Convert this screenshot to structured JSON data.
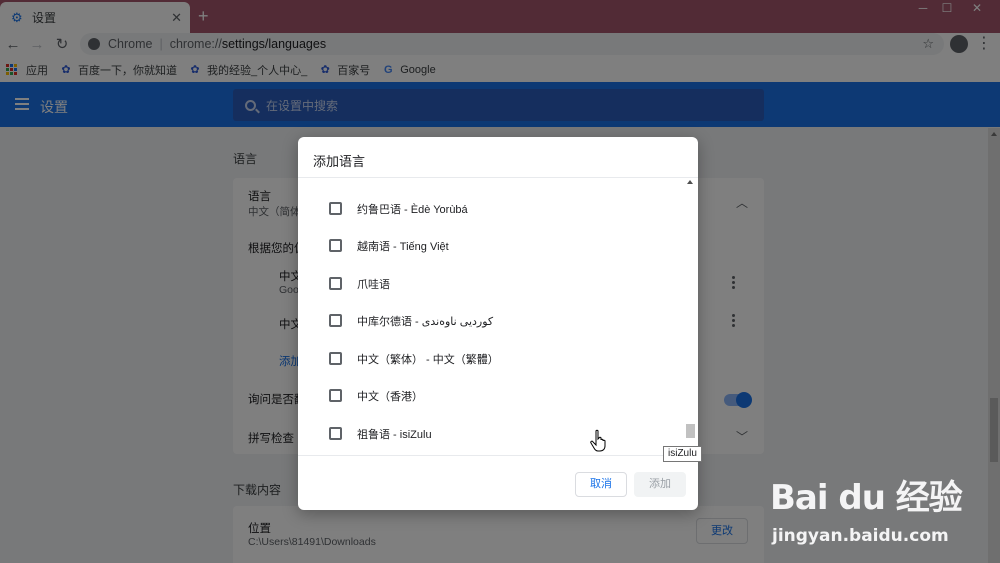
{
  "browser": {
    "tab": {
      "title": "设置",
      "icon": "gear-icon"
    },
    "window_controls": {
      "minimize": "─",
      "maximize": "☐",
      "close": "✕"
    },
    "omnibox": {
      "origin": "Chrome",
      "url_scheme": "chrome://",
      "url_path": "settings/languages"
    },
    "bookmarks": [
      {
        "label": "应用",
        "icon": "apps-grid-icon"
      },
      {
        "label": "百度一下，你就知道",
        "icon": "baidu-paw-icon"
      },
      {
        "label": "我的经验_个人中心_",
        "icon": "baidu-paw-icon"
      },
      {
        "label": "百家号",
        "icon": "baidu-paw-icon"
      },
      {
        "label": "Google",
        "icon": "google-g-icon"
      }
    ]
  },
  "settings": {
    "title": "设置",
    "search_placeholder": "在设置中搜索",
    "languages_section_title": "语言",
    "languages_card": {
      "label": "语言",
      "sub": "中文（简体",
      "order_label": "根据您的偏",
      "items": [
        {
          "name": "中文",
          "sub": "Goo"
        },
        {
          "name": "中文",
          "sub": ""
        }
      ],
      "add_link": "添加",
      "ask_translate": "询问是否翻",
      "spellcheck": "拼写检查"
    },
    "downloads_section_title": "下载内容",
    "downloads_card": {
      "location_label": "位置",
      "location_path": "C:\\Users\\81491\\Downloads",
      "change_button": "更改"
    }
  },
  "dialog": {
    "title": "添加语言",
    "languages": [
      {
        "name": "约鲁巴语 - Èdè Yorùbá",
        "checked": false
      },
      {
        "name": "越南语 - Tiếng Việt",
        "checked": false
      },
      {
        "name": "爪哇语",
        "checked": false
      },
      {
        "name": "中库尔德语 - کوردیی ناوەندی",
        "checked": false
      },
      {
        "name": "中文（繁体） - 中文（繁體）",
        "checked": false
      },
      {
        "name": "中文（香港）",
        "checked": false
      },
      {
        "name": "祖鲁语 - isiZulu",
        "checked": false
      }
    ],
    "cancel_label": "取消",
    "add_label": "添加",
    "tooltip": "isiZulu"
  },
  "watermark": {
    "brand": "Bai du 经验",
    "url": "jingyan.baidu.com"
  },
  "colors": {
    "titlebar": "#a4566c",
    "accent": "#1a73e8"
  }
}
